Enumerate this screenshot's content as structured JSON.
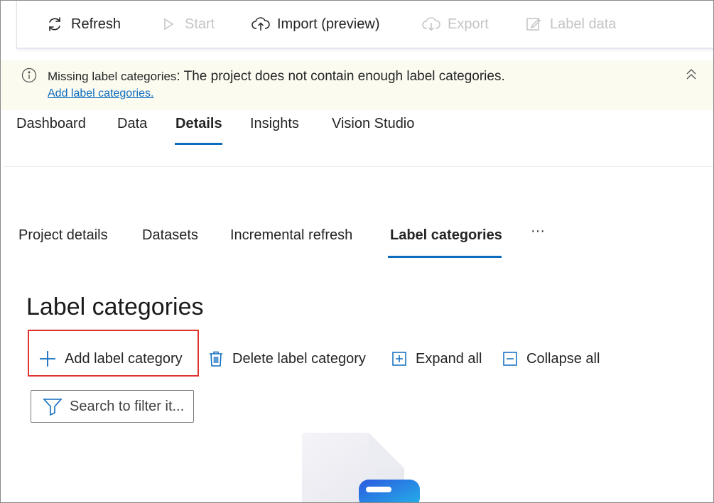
{
  "toolbar": {
    "refresh": "Refresh",
    "start": "Start",
    "import": "Import (preview)",
    "export": "Export",
    "label_data": "Label data"
  },
  "banner": {
    "title": "Missing label categories",
    "message": ": The project does not contain enough label categories.",
    "link": "Add label categories."
  },
  "main_tabs": [
    "Dashboard",
    "Data",
    "Details",
    "Insights",
    "Vision Studio"
  ],
  "sub_tabs": [
    "Project details",
    "Datasets",
    "Incremental refresh",
    "Label categories",
    "···"
  ],
  "page": {
    "title": "Label categories",
    "add": "Add label category",
    "delete": "Delete label category",
    "expand": "Expand all",
    "collapse": "Collapse all",
    "search_placeholder": "Search to filter it..."
  },
  "colors": {
    "accent": "#0f6cbd",
    "highlight": "#e0322f",
    "banner_bg": "#fbfbf0"
  }
}
